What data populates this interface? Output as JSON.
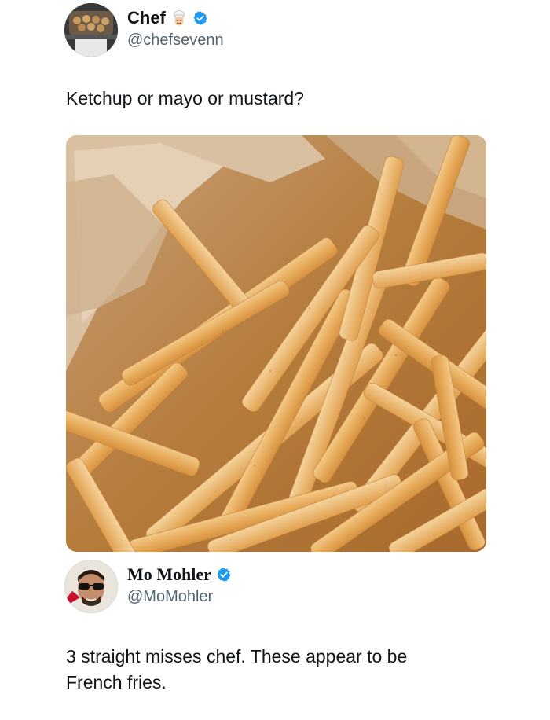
{
  "tweet": {
    "author_name": "Chef",
    "author_emoji": "chef-emoji",
    "author_handle": "@chefsevenn",
    "text": "Ketchup or mayo or mustard?",
    "image_alt": "french-fries-photo"
  },
  "reply": {
    "author_name": "Mo Mohler",
    "author_handle": "@MoMohler",
    "text_line1": "3 straight misses chef. These appear to be",
    "text_line2": "French fries."
  },
  "colors": {
    "verified": "#1d9bf0",
    "handle": "#536471",
    "text": "#0f1419"
  }
}
